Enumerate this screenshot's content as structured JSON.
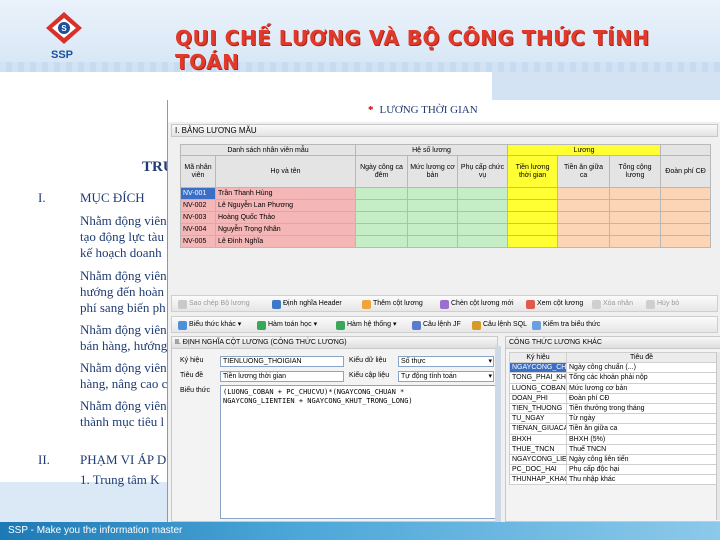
{
  "slide": {
    "title": "QUI CHẾ LƯƠNG VÀ BỘ CÔNG THỨC TÍNH TOÁN",
    "logo_text": "SSP",
    "footer": "SSP - Make you the information master",
    "section_heading": "TRU",
    "sections": [
      {
        "num": "I.",
        "heading": "MỤC ĐÍCH"
      },
      {
        "num": "II.",
        "heading": "PHẠM VI ÁP D"
      }
    ],
    "paragraphs": [
      [
        "Nhằm động viên",
        "tạo động lực tàu",
        "kế hoạch doanh"
      ],
      [
        "Nhằm động viên",
        "hướng đến hoàn",
        "phí sang biến ph"
      ],
      [
        "Nhằm động viên",
        "bán hàng, hướng"
      ],
      [
        "Nhằm động viên",
        "hàng, nâng cao c"
      ],
      [
        "Nhằm động viên",
        "thành mục tiêu l"
      ]
    ],
    "scope_item": "1.   Trung tâm K"
  },
  "app": {
    "tab_title": "LƯƠNG THỜI GIAN",
    "section1_title": "I. BẢNG LƯƠNG MẪU",
    "group_headers": {
      "employees": "Danh sách nhân viên mẫu",
      "coef": "Hệ số lương",
      "salary": "Lương"
    },
    "columns": [
      "Mã nhân viên",
      "Họ và tên",
      "Ngày công ca đêm",
      "Mức lương cơ bản",
      "Phụ cấp chức vụ",
      "Tiền lương thời gian",
      "Tiền ăn giữa ca",
      "Tổng cộng lương",
      "Đoàn phí CĐ"
    ],
    "employees": [
      {
        "id": "NV-001",
        "name": "Trần Thanh Hùng"
      },
      {
        "id": "NV-002",
        "name": "Lê Nguyễn Lan Phương"
      },
      {
        "id": "NV-003",
        "name": "Hoàng Quốc Thảo"
      },
      {
        "id": "NV-004",
        "name": "Nguyễn Trọng Nhân"
      },
      {
        "id": "NV-005",
        "name": "Lê Đình Nghĩa"
      }
    ],
    "toolbar1": {
      "copy": "Sao chép Bộ lương",
      "define_header": "Định nghĩa Header",
      "add_column": "Thêm cột lương",
      "insert_column": "Chèn cột lương mới",
      "view_column": "Xem cột lương",
      "delete": "Xóa nhân",
      "cancel": "Hủy bỏ"
    },
    "toolbar2": {
      "expression": "Biểu thức khác",
      "math": "Hàm toán học",
      "system": "Hàm hệ thống",
      "sql_jf": "Câu lệnh JF",
      "sql": "Câu lệnh SQL",
      "check": "Kiểm tra biểu thức"
    },
    "define_panel": {
      "title": "II. ĐỊNH NGHĨA CỘT LƯƠNG (CÔNG THỨC LƯƠNG)",
      "symbol_label": "Ký hiệu",
      "symbol_value": "TIENLUONG_THOIGIAN",
      "datatype_label": "Kiểu dữ liệu",
      "datatype_value": "Số thực",
      "header_label": "Tiêu đề",
      "header_value": "Tiền lương thời gian",
      "formula_type_label": "Kiểu cập liệu",
      "formula_type_value": "Tự động tính toán",
      "expr_label": "Biểu thức",
      "expr_lines": [
        "(LUONG_COBAN + PC_CHUCVU)*(NGAYCONG_CHUAN *",
        "NGAYCONG_LIENTIEN + NGAYCONG_KHUT_TRONG_LONG)"
      ]
    },
    "formula_list": {
      "title": "CÔNG THỨC LƯƠNG KHÁC",
      "headers": [
        "Ký hiệu",
        "Tiêu đề"
      ],
      "rows": [
        [
          "NGAYCONG_CHUAN",
          "Ngày công chuẩn (...)"
        ],
        [
          "TONG_PHAI_KHOAN",
          "Tổng các khoản phải nộp"
        ],
        [
          "LUONG_COBAN",
          "Mức lương cơ bản"
        ],
        [
          "DOAN_PHI",
          "Đoàn phí CĐ"
        ],
        [
          "TIEN_THUONG",
          "Tiền thưởng trong tháng"
        ],
        [
          "TU_NGAY",
          "Từ ngày"
        ],
        [
          "TIENAN_GIUACA",
          "Tiền ăn giữa ca"
        ],
        [
          "BHXH",
          "BHXH (5%)"
        ],
        [
          "THUE_TNCN",
          "Thuế TNCN"
        ],
        [
          "NGAYCONG_LIENTIEN",
          "Ngày công liên tiến"
        ],
        [
          "PC_DOC_HAI",
          "Phụ cấp độc hại"
        ],
        [
          "THUNHAP_KHAC",
          "Thu nhập khác"
        ]
      ]
    }
  },
  "colors": {
    "title_red": "#e13a2a",
    "pink": "#f4b6b6",
    "green": "#c6eec6",
    "yellow": "#ffff33",
    "peach": "#fbd5b5"
  }
}
